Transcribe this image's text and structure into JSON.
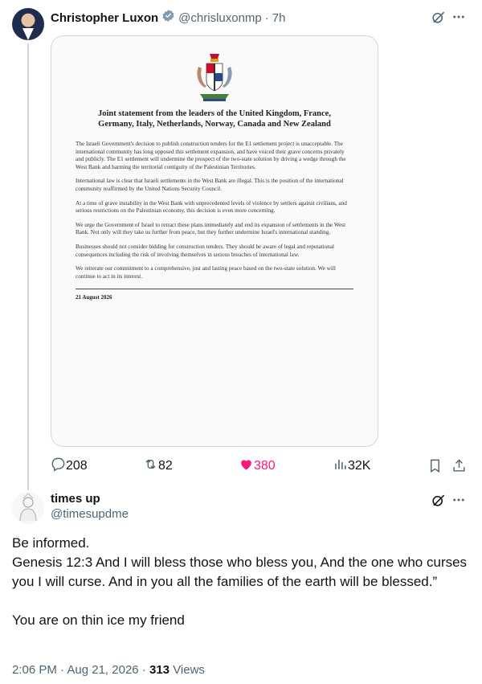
{
  "tweet": {
    "author_name": "Christopher Luxon",
    "handle": "@chrisluxonmp",
    "separator": "·",
    "time": "7h",
    "image_document": {
      "title": "Joint statement from the leaders of the United Kingdom, France, Germany, Italy, Netherlands, Norway, Canada and New Zealand",
      "paragraphs": [
        "The Israeli Government's decision to publish construction tenders for the E1 settlement project is unacceptable. The international community has long opposed this settlement expansion, and have voiced their grave concerns privately and publicly. The E1 settlement will undermine the prospect of the two-state solution by driving a wedge through the West Bank and harming the territorial contiguity of the Palestinian Territories.",
        "International law is clear that Israeli settlements in the West Bank are illegal. This is the position of the international community reaffirmed by the United Nations Security Council.",
        "At a time of grave instability in the West Bank with unprecedented levels of violence by settlers against civilians, and serious restrictions on the Palestinian economy, this decision is even more concerning.",
        "We urge the Government of Israel to retract these plans immediately and end its expansion of settlements in the West Bank. Not only will they take us further from peace, but they further undermine Israel's international standing.",
        "Businesses should not consider bidding for construction tenders. They should be aware of legal and reputational consequences including the risk of involving themselves in serious breaches of international law.",
        "We reiterate our commitment to a comprehensive, just and lasting peace based on the two-state solution. We will continue to act in its interest."
      ],
      "date": "21 August 2026"
    },
    "stats": {
      "replies": "208",
      "reposts": "82",
      "likes": "380",
      "views": "32K"
    },
    "colors": {
      "like": "#f91880",
      "muted": "#536471"
    }
  },
  "reply": {
    "author_name": "times up",
    "handle": "@timesupdme",
    "text": "Be informed.\nGenesis 12:3 And I will bless those who bless you, And the one who curses you I will curse. And in you all the families of the earth will be blessed.”\n\nYou are on thin ice my friend",
    "time": "2:06 PM",
    "dot": "·",
    "date": "Aug 21, 2026",
    "views_count": "313",
    "views_label": "Views"
  },
  "icons": {
    "verified": "verified-badge-icon",
    "grok": "grok-icon",
    "more": "more-icon",
    "reply": "reply-icon",
    "repost": "repost-icon",
    "like": "like-heart-icon",
    "views": "views-chart-icon",
    "bookmark": "bookmark-icon",
    "share": "share-icon"
  }
}
